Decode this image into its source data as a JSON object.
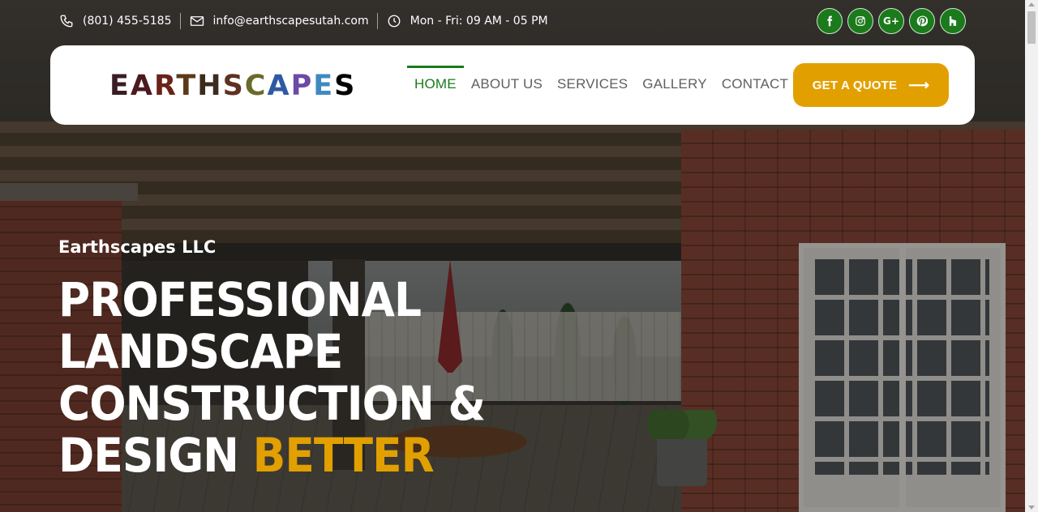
{
  "topbar": {
    "phone": "(801) 455-5185",
    "email": "info@earthscapesutah.com",
    "hours": "Mon - Fri: 09 AM - 05 PM"
  },
  "socials": [
    {
      "name": "facebook-icon",
      "glyph": "f"
    },
    {
      "name": "instagram-icon",
      "glyph": ""
    },
    {
      "name": "google-plus-icon",
      "glyph": "G+"
    },
    {
      "name": "pinterest-icon",
      "glyph": ""
    },
    {
      "name": "houzz-icon",
      "glyph": "h"
    }
  ],
  "brand": {
    "logo_text": "EARTHSCAPES",
    "accent_color": "#e2a000",
    "green_color": "#1b7a1b"
  },
  "nav": {
    "items": [
      {
        "label": "HOME",
        "active": true
      },
      {
        "label": "ABOUT US",
        "active": false
      },
      {
        "label": "SERVICES",
        "active": false
      },
      {
        "label": "GALLERY",
        "active": false
      },
      {
        "label": "CONTACT US",
        "active": false
      }
    ],
    "cta_label": "GET A QUOTE"
  },
  "hero": {
    "subtitle": "Earthscapes LLC",
    "title_line1": "PROFESSIONAL",
    "title_line2": "LANDSCAPE",
    "title_line3": "CONSTRUCTION &",
    "title_line4_a": "DESIGN",
    "title_line4_b": "BETTER"
  }
}
